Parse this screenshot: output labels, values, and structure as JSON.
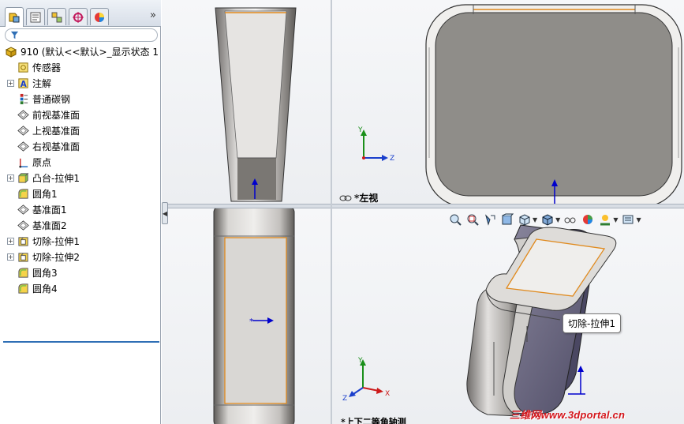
{
  "panel": {
    "tabs": [
      "feature-manager",
      "property-manager",
      "configuration-manager",
      "dimxpert-manager",
      "display-manager"
    ],
    "more_label": "»",
    "tree": {
      "root": {
        "label": "910 (默认<<默认>_显示状态 1"
      },
      "items": [
        {
          "label": "传感器",
          "icon": "sensors-icon",
          "expandable": false
        },
        {
          "label": "注解",
          "icon": "annotations-icon",
          "expandable": true
        },
        {
          "label": "普通碳钢",
          "icon": "material-icon",
          "expandable": false
        },
        {
          "label": "前视基准面",
          "icon": "plane-icon",
          "expandable": false
        },
        {
          "label": "上视基准面",
          "icon": "plane-icon",
          "expandable": false
        },
        {
          "label": "右视基准面",
          "icon": "plane-icon",
          "expandable": false
        },
        {
          "label": "原点",
          "icon": "origin-icon",
          "expandable": false
        },
        {
          "label": "凸台-拉伸1",
          "icon": "extrude-boss-icon",
          "expandable": true
        },
        {
          "label": "圆角1",
          "icon": "fillet-icon",
          "expandable": false
        },
        {
          "label": "基准面1",
          "icon": "plane-icon",
          "expandable": false
        },
        {
          "label": "基准面2",
          "icon": "plane-icon",
          "expandable": false
        },
        {
          "label": "切除-拉伸1",
          "icon": "extrude-cut-icon",
          "expandable": true
        },
        {
          "label": "切除-拉伸2",
          "icon": "extrude-cut-icon",
          "expandable": true
        },
        {
          "label": "圆角3",
          "icon": "fillet-icon",
          "expandable": false
        },
        {
          "label": "圆角4",
          "icon": "fillet-icon",
          "expandable": false
        }
      ]
    }
  },
  "viewports": {
    "top_right_label": "*左视",
    "bottom_right_label": "*上下二等角轴测",
    "triad_axes": {
      "x": "X",
      "y": "Y",
      "z": "Z"
    }
  },
  "heads_up_toolbar": [
    "zoom-to-fit-icon",
    "zoom-to-area-icon",
    "previous-view-icon",
    "section-view-icon",
    "view-orientation-icon",
    "display-style-icon",
    "hide-show-items-icon",
    "edit-appearance-icon",
    "apply-scene-icon",
    "view-settings-icon"
  ],
  "tooltip": "切除-拉伸1",
  "watermark": "三维网www.3dportal.cn",
  "colors": {
    "accent": "#2f6fb5",
    "edge_highlight": "#e08a1e",
    "part_face": "#8f8d89",
    "watermark": "#d4161c"
  }
}
